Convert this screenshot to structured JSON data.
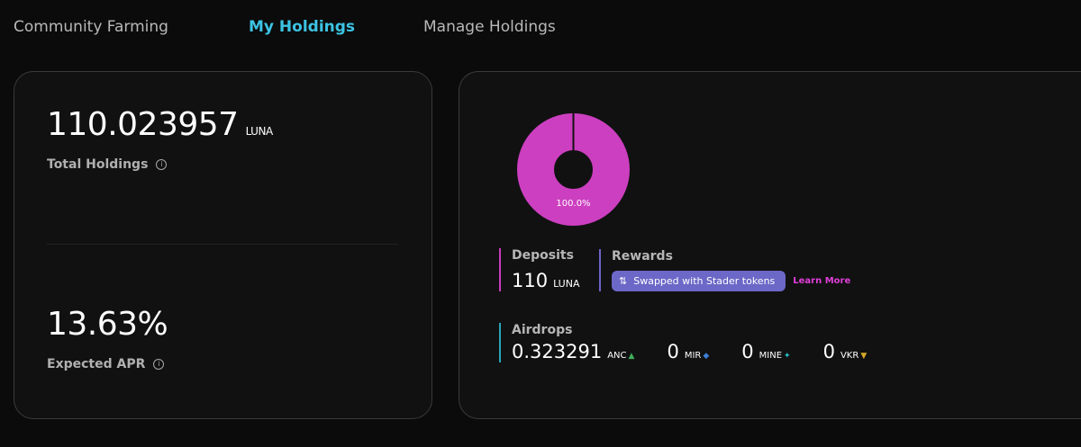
{
  "tabs": [
    {
      "label": "Community Farming"
    },
    {
      "label": "My Holdings"
    },
    {
      "label": "Manage Holdings"
    }
  ],
  "holdings": {
    "total_value": "110.023957",
    "total_unit": "LUNA",
    "total_label": "Total Holdings",
    "apr_value": "13.63%",
    "apr_label": "Expected APR",
    "info_glyph": "i"
  },
  "donut": {
    "percent_label": "100.0%",
    "fraction": 1.0,
    "color": "#cc3fc0"
  },
  "deposits": {
    "title": "Deposits",
    "value": "110",
    "unit": "LUNA"
  },
  "rewards": {
    "title": "Rewards",
    "swap_icon": "swap-icon",
    "swap_glyph": "⇅",
    "swap_label": "Swapped with Stader tokens",
    "learn_more": "Learn More"
  },
  "airdrops": {
    "title": "Airdrops",
    "items": [
      {
        "value": "0.323291",
        "token": "ANC",
        "icon": "anc-icon",
        "glyph": "▲",
        "color": "#3fae5b"
      },
      {
        "value": "0",
        "token": "MIR",
        "icon": "mir-icon",
        "glyph": "◆",
        "color": "#3b7fd6"
      },
      {
        "value": "0",
        "token": "MINE",
        "icon": "mine-icon",
        "glyph": "✦",
        "color": "#27c2c9"
      },
      {
        "value": "0",
        "token": "VKR",
        "icon": "vkr-icon",
        "glyph": "▼",
        "color": "#d8a928"
      }
    ]
  },
  "colors": {
    "accent_tab": "#3cc3e3",
    "pill": "#6c68c7",
    "learn_more": "#e03fd8"
  }
}
